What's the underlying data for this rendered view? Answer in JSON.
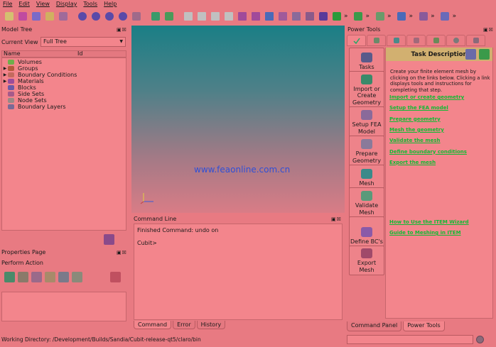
{
  "menu": [
    "File",
    "Edit",
    "View",
    "Display",
    "Tools",
    "Help"
  ],
  "toolbar": {
    "icons": [
      "new-file-icon",
      "open-icon",
      "save-icon",
      "edit-icon",
      "script-icon",
      "play-icon",
      "step-icon",
      "play-all-icon",
      "pause-icon",
      "settings-wrench-icon",
      "geometry-icon",
      "undo-icon",
      "cube-1-icon",
      "cube-2-icon",
      "cube-3-icon",
      "cube-4-icon",
      "cube-5-icon",
      "cube-6-icon",
      "cube-7-icon",
      "cube-8-icon",
      "cube-9-icon",
      "cube-10-icon",
      "rotate-icon",
      "zoom-icon",
      "mesh-icon",
      "axis-icon",
      "pick-icon",
      "measure-icon",
      "tools-icon"
    ],
    "chevron": "»"
  },
  "model_tree": {
    "title": "Model Tree",
    "current_view_label": "Current View",
    "current_view_value": "Full Tree",
    "col_name": "Name",
    "col_id": "Id",
    "items": [
      {
        "label": "Volumes",
        "color": "#6fae4b",
        "expand": ""
      },
      {
        "label": "Groups",
        "color": "#b45a3c",
        "expand": "▶"
      },
      {
        "label": "Boundary Conditions",
        "color": "#c46a5e",
        "expand": "▶"
      },
      {
        "label": "Materials",
        "color": "#9c4d9a",
        "expand": "▶"
      },
      {
        "label": "Blocks",
        "color": "#6c5aa8",
        "expand": ""
      },
      {
        "label": "Side Sets",
        "color": "#a65a8a",
        "expand": ""
      },
      {
        "label": "Node Sets",
        "color": "#9a8a86",
        "expand": ""
      },
      {
        "label": "Boundary Layers",
        "color": "#7a6a96",
        "expand": ""
      }
    ]
  },
  "properties": {
    "title": "Properties Page",
    "perform_action": "Perform Action"
  },
  "viewport": {
    "watermark": "www.feaonline.com.cn"
  },
  "command_line": {
    "title": "Command Line",
    "lines": [
      "Finished Command: undo on",
      "",
      "Cubit>"
    ],
    "tabs": [
      "Command",
      "Error",
      "History"
    ]
  },
  "power_tools": {
    "title": "Power Tools",
    "task_title": "Task Description",
    "description": "Create your finite element mesh by clicking on the links below. Clicking a link displays tools and instructions for completing that step.",
    "buttons": [
      {
        "label": "Tasks",
        "icon": "tasks-icon"
      },
      {
        "label": "Import or Create Geometry",
        "icon": "import-geometry-icon"
      },
      {
        "label": "Setup FEA Model",
        "icon": "setup-fea-icon"
      },
      {
        "label": "Prepare Geometry",
        "icon": "prepare-geometry-icon"
      },
      {
        "label": "Mesh",
        "icon": "mesh-cube-icon"
      },
      {
        "label": "Validate Mesh",
        "icon": "validate-mesh-icon"
      },
      {
        "label": "Define BC's",
        "icon": "define-bc-icon"
      },
      {
        "label": "Export Mesh",
        "icon": "export-mesh-icon"
      }
    ],
    "links": [
      "Import or create geometry",
      "Setup the FEA model",
      "Prepare geometry",
      "Mesh the geometry",
      "Validate the mesh",
      "Define boundary conditions",
      "Export the mesh"
    ],
    "help_links": [
      "How to Use the ITEM Wizard",
      "Guide to Meshing in ITEM"
    ],
    "bottom_tabs": [
      "Command Panel",
      "Power Tools"
    ]
  },
  "status": {
    "working_directory": "Working Directory: /Development/Builds/Sandia/Cubit-release-qt5/claro/bin"
  },
  "colors": {
    "background": "#e87a82",
    "accent": "#1b3"
  }
}
